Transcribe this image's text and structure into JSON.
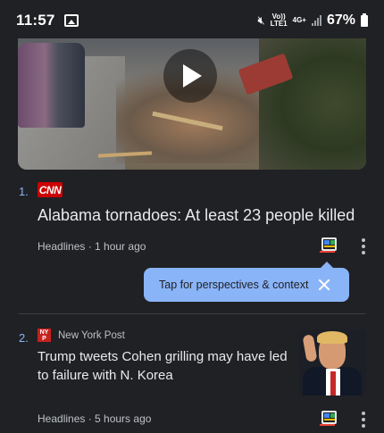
{
  "status_bar": {
    "time": "11:57",
    "net_top": "4G+",
    "net_bottom": "LTE1",
    "volte": "Vo))",
    "battery_percent": "67%"
  },
  "icons": {
    "gallery": "image-icon",
    "mute": "mute-icon",
    "signal": "signal-icon",
    "battery": "battery-icon",
    "play": "play-icon",
    "perspectives": "full-coverage-icon",
    "more": "more-vert-icon",
    "close": "close-icon"
  },
  "articles": [
    {
      "index": "1.",
      "source_logo": "CNN",
      "title": "Alabama tornadoes: At least 23 people killed",
      "meta": "Headlines · 1 hour ago"
    },
    {
      "index": "2.",
      "source_logo": "NEW YORK POST",
      "source": "New York Post",
      "title": "Trump tweets Cohen grilling may have led to failure with N. Korea",
      "meta": "Headlines · 5 hours ago"
    }
  ],
  "tooltip": {
    "text": "Tap for perspectives & context"
  },
  "colors": {
    "background": "#202124",
    "accent": "#8ab4f8",
    "cnn_red": "#cc0000",
    "nyp_red": "#c5221f"
  }
}
